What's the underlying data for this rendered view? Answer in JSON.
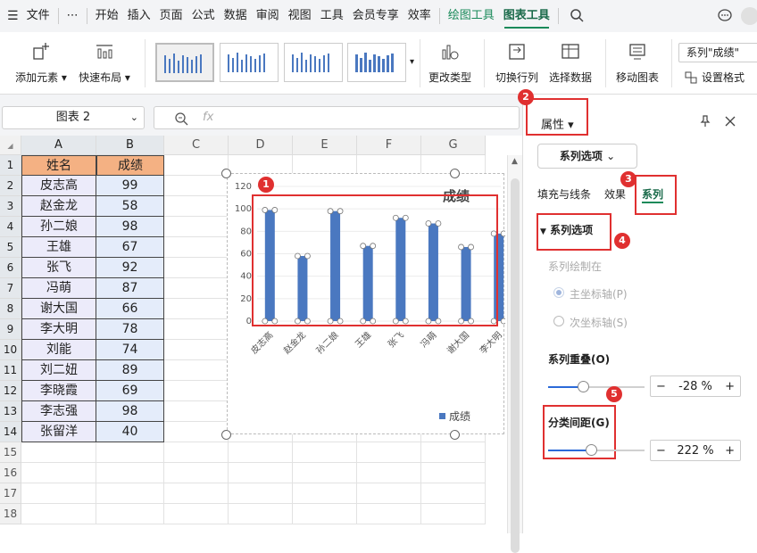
{
  "menubar": {
    "items": [
      "文件",
      "开始",
      "插入",
      "页面",
      "公式",
      "数据",
      "审阅",
      "视图",
      "工具",
      "会员专享",
      "效率",
      "绘图工具",
      "图表工具"
    ],
    "more": "⋯"
  },
  "ribbon": {
    "add_element": "添加元素",
    "quick_layout": "快速布局",
    "change_type": "更改类型",
    "switch_rowcol": "切换行列",
    "select_data": "选择数据",
    "move_chart": "移动图表",
    "series_selector": "系列\"成绩\"",
    "set_format": "设置格式"
  },
  "formula": {
    "name_box": "图表 2",
    "fx": "fx",
    "value": ""
  },
  "sheet": {
    "columns": [
      "A",
      "B",
      "C",
      "D",
      "E",
      "F",
      "G"
    ],
    "rows": [
      "1",
      "2",
      "3",
      "4",
      "5",
      "6",
      "7",
      "8",
      "9",
      "10",
      "11",
      "12",
      "13",
      "14",
      "15",
      "16",
      "17",
      "18"
    ],
    "header": [
      "姓名",
      "成绩"
    ],
    "data": [
      [
        "皮志高",
        "99"
      ],
      [
        "赵金龙",
        "58"
      ],
      [
        "孙二娘",
        "98"
      ],
      [
        "王雄",
        "67"
      ],
      [
        "张飞",
        "92"
      ],
      [
        "冯萌",
        "87"
      ],
      [
        "谢大国",
        "66"
      ],
      [
        "李大明",
        "78"
      ],
      [
        "刘能",
        "74"
      ],
      [
        "刘二妞",
        "89"
      ],
      [
        "李晓霞",
        "69"
      ],
      [
        "李志强",
        "98"
      ],
      [
        "张留洋",
        "40"
      ]
    ]
  },
  "chart_data": {
    "type": "bar",
    "title": "成绩",
    "categories": [
      "皮志高",
      "赵金龙",
      "孙二娘",
      "王雄",
      "张飞",
      "冯萌",
      "谢大国",
      "李大明"
    ],
    "series": [
      {
        "name": "成绩",
        "values": [
          99,
          58,
          98,
          67,
          92,
          87,
          66,
          78
        ]
      }
    ],
    "ylim": [
      0,
      120
    ],
    "yticks": [
      "0",
      "20",
      "40",
      "60",
      "80",
      "100",
      "120"
    ],
    "legend": "bottom-right",
    "bar_color": "#4a78c0"
  },
  "panel": {
    "title": "属性",
    "series_options_dropdown": "系列选项",
    "tabs": [
      "填充与线条",
      "效果",
      "系列"
    ],
    "section": "系列选项",
    "plot_on": "系列绘制在",
    "primary_axis": "主坐标轴(P)",
    "secondary_axis": "次坐标轴(S)",
    "overlap_label": "系列重叠(O)",
    "overlap_value": "-28",
    "overlap_percent": -28,
    "gap_label": "分类间距(G)",
    "gap_value": "222",
    "gap_percent": 222,
    "percent_unit": "%"
  },
  "badges": [
    "1",
    "2",
    "3",
    "4",
    "5"
  ],
  "colors": {
    "accent": "#1a8a5a",
    "highlight": "#e03030",
    "header_fill": "#f4b183"
  }
}
